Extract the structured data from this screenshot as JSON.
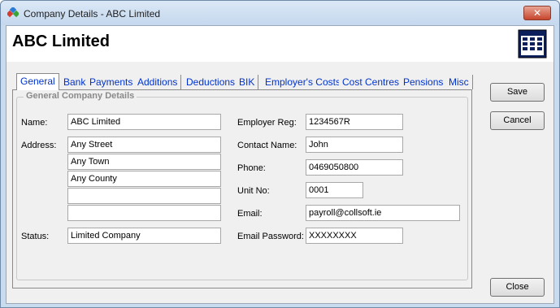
{
  "window": {
    "title": "Company Details - ABC Limited",
    "close_glyph": "✕"
  },
  "header": {
    "company_name": "ABC Limited",
    "icon": "calendar-grid-icon"
  },
  "tabs": [
    {
      "label": "General",
      "active": true
    },
    {
      "label": "Bank"
    },
    {
      "label": "Payments"
    },
    {
      "label": "Additions"
    },
    {
      "label": "Deductions"
    },
    {
      "label": "BIK"
    },
    {
      "label": "Employer's Costs"
    },
    {
      "label": "Cost Centres"
    },
    {
      "label": "Pensions"
    },
    {
      "label": "Misc"
    }
  ],
  "group": {
    "title": "General Company Details"
  },
  "form_left": {
    "name_label": "Name:",
    "name_value": "ABC Limited",
    "address_label": "Address:",
    "address_lines": [
      "Any Street",
      "Any Town",
      "Any County",
      "",
      ""
    ],
    "status_label": "Status:",
    "status_value": "Limited Company"
  },
  "form_right": {
    "employer_reg_label": "Employer Reg:",
    "employer_reg_value": "1234567R",
    "contact_label": "Contact Name:",
    "contact_value": "John",
    "phone_label": "Phone:",
    "phone_value": "0469050800",
    "unit_label": "Unit No:",
    "unit_value": "0001",
    "email_label": "Email:",
    "email_value": "payroll@collsoft.ie",
    "email_password_label": "Email Password:",
    "email_password_value": "XXXXXXXX"
  },
  "buttons": {
    "save": "Save",
    "cancel": "Cancel",
    "close": "Close"
  },
  "colors": {
    "tab_text": "#0033cc",
    "close_button": "#c7452c"
  }
}
